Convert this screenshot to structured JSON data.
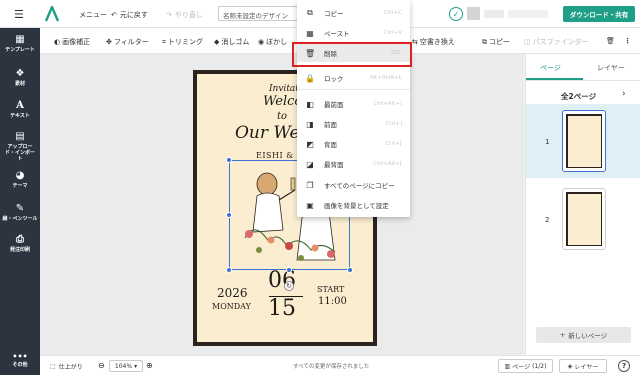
{
  "header": {
    "menu_label": "メニュー",
    "undo_label": "元に戻す",
    "redo_label": "やり直し",
    "doc_title": "名称未設定のデザイン",
    "download_label": "ダウンロード・共有"
  },
  "toolbar": {
    "items": [
      "画像補正",
      "フィルター",
      "トリミング",
      "消しゴム",
      "ぼかし"
    ],
    "replace_label": "空書き換え",
    "copy_label": "コピー",
    "pathfinder_label": "パスファインダー"
  },
  "sidebar": {
    "items": [
      {
        "label": "テンプレート"
      },
      {
        "label": "素材"
      },
      {
        "label": "テキスト"
      },
      {
        "label": "アップロード・インポート"
      },
      {
        "label": "テーマ"
      },
      {
        "label": "線・ペンツール"
      },
      {
        "label": "発注印刷"
      }
    ],
    "more_label": "その他"
  },
  "context_menu": {
    "items": [
      {
        "icon": "copy-icon",
        "label": "コピー",
        "shortcut": "Ctrl+C"
      },
      {
        "icon": "paste-icon",
        "label": "ペースト",
        "shortcut": "Ctrl+V"
      },
      {
        "icon": "trash-icon",
        "label": "削除",
        "shortcut": "DEL",
        "highlight": true
      },
      {
        "icon": "lock-icon",
        "label": "ロック",
        "shortcut": "Alt+Shift+L"
      },
      {
        "icon": "bring-to-front-icon",
        "label": "最前面",
        "shortcut": "Ctrl+Alt+]"
      },
      {
        "icon": "bring-forward-icon",
        "label": "前面",
        "shortcut": "Ctrl+]"
      },
      {
        "icon": "send-backward-icon",
        "label": "背面",
        "shortcut": "Ctrl+["
      },
      {
        "icon": "send-to-back-icon",
        "label": "最背面",
        "shortcut": "Ctrl+Alt+["
      },
      {
        "icon": "copy-to-all-pages-icon",
        "label": "すべてのページにコピー",
        "shortcut": ""
      },
      {
        "icon": "set-as-background-icon",
        "label": "画像を背景として設定",
        "shortcut": ""
      }
    ]
  },
  "design": {
    "invitation": "Invitatio",
    "welcome": "Welco",
    "to": "to",
    "our_wedding": "Our We",
    "names": "EISHI & WA",
    "year": "2026",
    "weekday": "MONDAY",
    "month": "06",
    "day": "15",
    "start_label": "START",
    "start_time": "11:00"
  },
  "right_panel": {
    "tab_pages": "ページ",
    "tab_layers": "レイヤー",
    "page_count_label": "全2ページ",
    "pages": [
      {
        "number": "1"
      },
      {
        "number": "2"
      }
    ],
    "new_page_label": "新しいページ"
  },
  "bottom_bar": {
    "finish_label": "仕上がり",
    "zoom": "104%",
    "status": "すべての変更が保存されました",
    "page_label": "ページ",
    "page_indicator": "(1/2)",
    "layers_label": "レイヤー",
    "help": "?"
  },
  "colors": {
    "accent": "#1f9e88",
    "sidebar": "#2c3440",
    "card_border": "#2b231e",
    "card_bg": "#fbedd0",
    "highlight_border": "#e02020",
    "selection": "#3a72d8"
  }
}
